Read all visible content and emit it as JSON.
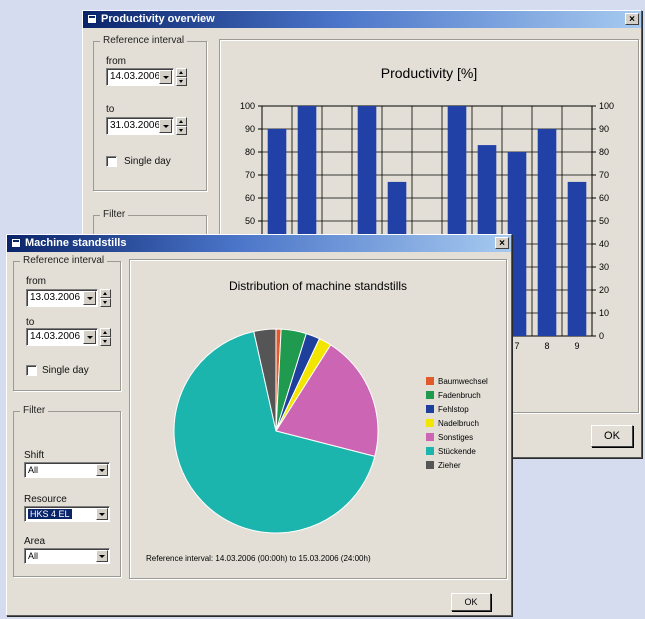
{
  "productivity_window": {
    "title": "Productivity overview",
    "close": "×",
    "reference_interval": {
      "legend": "Reference interval",
      "from_label": "from",
      "from_value": "14.03.2006",
      "to_label": "to",
      "to_value": "31.03.2006",
      "single_day_label": "Single day"
    },
    "filter_legend": "Filter",
    "ok_label": "OK",
    "chart_data": {
      "type": "bar",
      "title": "Productivity [%]",
      "ylim": [
        0,
        100
      ],
      "y_ticks": [
        0,
        10,
        20,
        30,
        40,
        50,
        60,
        70,
        80,
        90,
        100
      ],
      "visible_x_ticks": [
        "7",
        "8",
        "9"
      ],
      "values": [
        90,
        100,
        null,
        100,
        67,
        null,
        100,
        83,
        80,
        90,
        67
      ],
      "bar_color": "#2141a6"
    }
  },
  "standstills_window": {
    "title": "Machine standstills",
    "close": "×",
    "reference_interval": {
      "legend": "Reference interval",
      "from_label": "from",
      "from_value": "13.03.2006",
      "to_label": "to",
      "to_value": "14.03.2006",
      "single_day_label": "Single day"
    },
    "filter": {
      "legend": "Filter",
      "shift_label": "Shift",
      "shift_value": "All",
      "resource_label": "Resource",
      "resource_value": "HKS 4 EL",
      "area_label": "Area",
      "area_value": "All"
    },
    "ok_label": "OK",
    "footer_text": "Reference interval: 14.03.2006 (00:00h) to 15.03.2006 (24:00h)",
    "chart_data": {
      "type": "pie",
      "title": "Distribution of machine standstills",
      "legend_position": "right",
      "slices": [
        {
          "name": "Baumwechsel",
          "value": 0.8,
          "color": "#e05a2b"
        },
        {
          "name": "Fadenbruch",
          "value": 4.0,
          "color": "#1f9a4e"
        },
        {
          "name": "Fehlstop",
          "value": 2.2,
          "color": "#1e3f9c"
        },
        {
          "name": "Nadelbruch",
          "value": 2.0,
          "color": "#f2e600"
        },
        {
          "name": "Sonstiges",
          "value": 20.0,
          "color": "#cc66b4"
        },
        {
          "name": "Stückende",
          "value": 67.5,
          "color": "#1bb5ad"
        },
        {
          "name": "Zieher",
          "value": 3.5,
          "color": "#555555"
        }
      ]
    }
  }
}
